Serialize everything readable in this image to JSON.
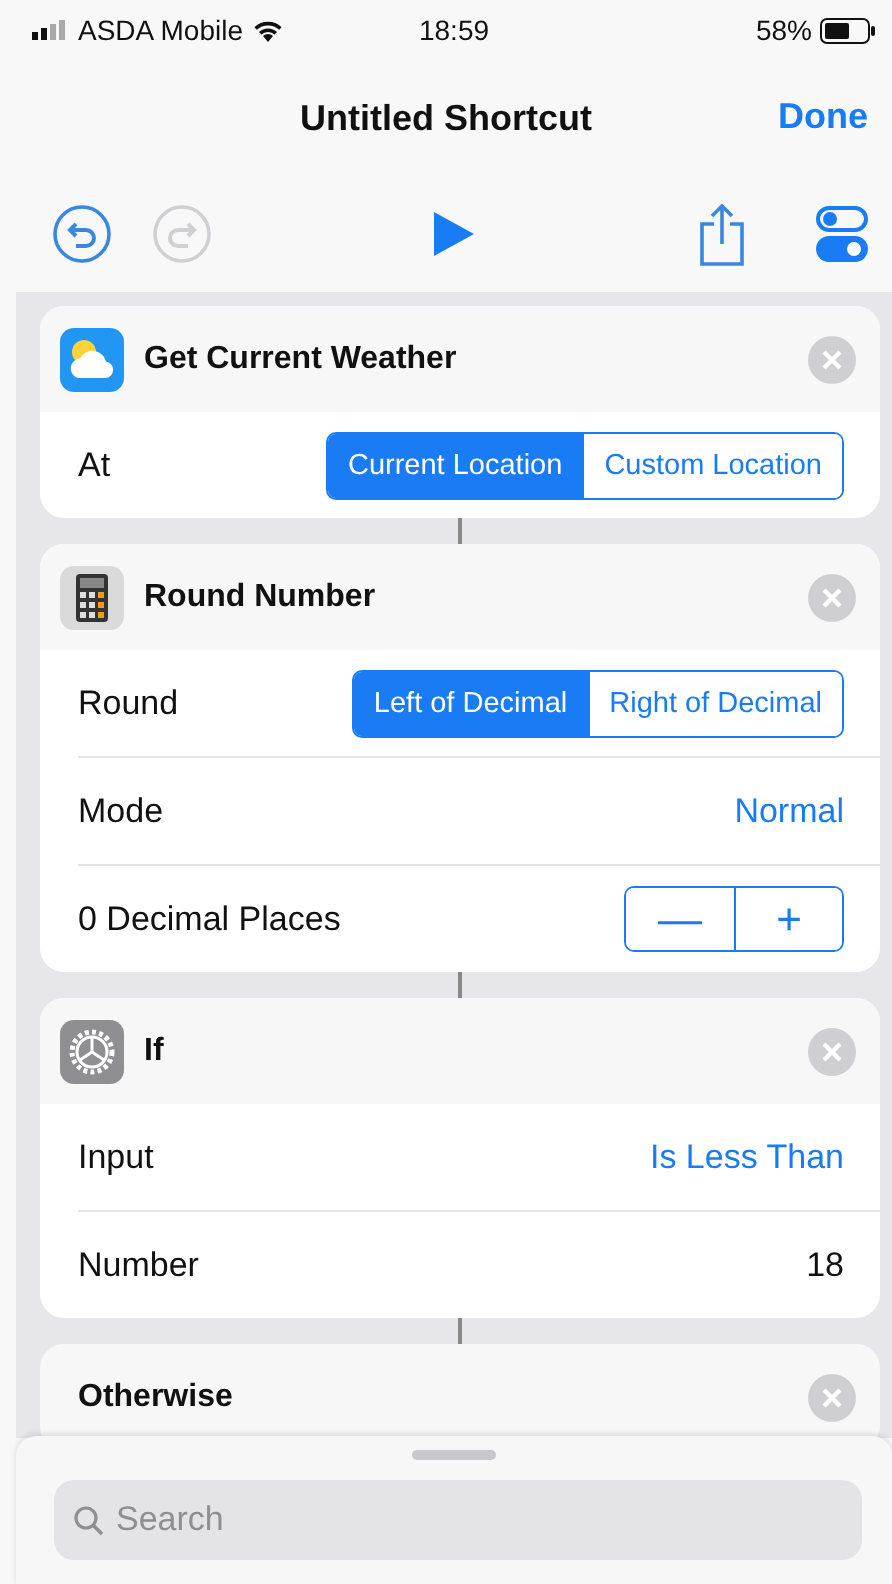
{
  "status_bar": {
    "carrier": "ASDA Mobile",
    "time": "18:59",
    "battery": "58%"
  },
  "nav": {
    "title": "Untitled Shortcut",
    "done": "Done"
  },
  "toolbar": {
    "undo": {
      "disabled": false
    },
    "redo": {
      "disabled": true
    }
  },
  "actions": [
    {
      "kind": "weather",
      "title": "Get Current Weather",
      "rows": [
        {
          "kind": "segmented",
          "label": "At",
          "options": [
            {
              "label": "Current Location",
              "selected": true
            },
            {
              "label": "Custom Location",
              "selected": false
            }
          ]
        }
      ]
    },
    {
      "kind": "calculator",
      "title": "Round Number",
      "rows": [
        {
          "kind": "segmented",
          "label": "Round",
          "options": [
            {
              "label": "Left of Decimal",
              "selected": true
            },
            {
              "label": "Right of Decimal",
              "selected": false
            }
          ]
        },
        {
          "kind": "picker",
          "label": "Mode",
          "value": "Normal"
        },
        {
          "kind": "stepper",
          "label": "0 Decimal Places",
          "minus": "—",
          "plus": "+"
        }
      ]
    },
    {
      "kind": "condition",
      "title": "If",
      "rows": [
        {
          "kind": "picker",
          "label": "Input",
          "value": "Is Less Than"
        },
        {
          "kind": "text",
          "label": "Number",
          "value": "18"
        }
      ]
    },
    {
      "kind": "branch",
      "title": "Otherwise"
    }
  ],
  "search": {
    "placeholder": "Search"
  }
}
